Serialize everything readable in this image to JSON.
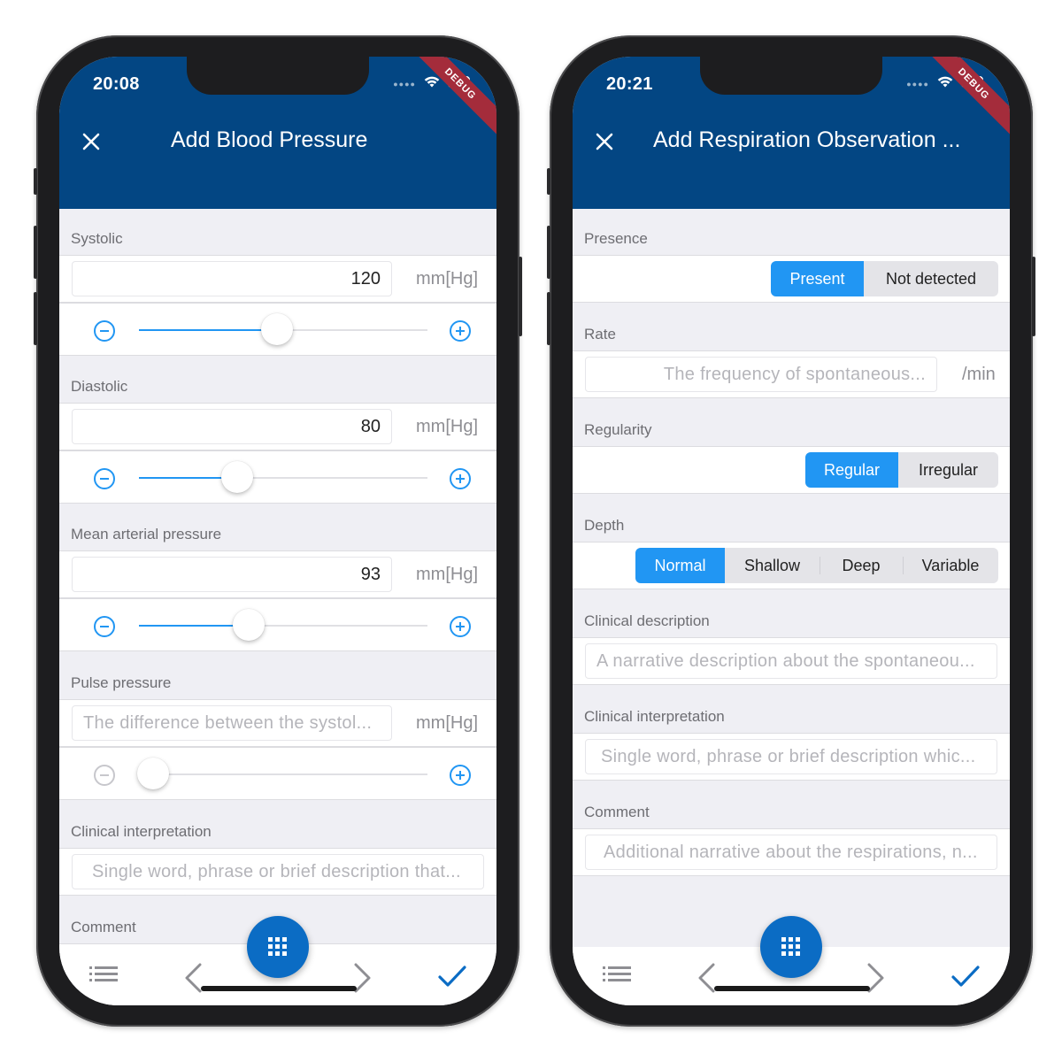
{
  "left_screen": {
    "status_time": "20:08",
    "debug_label": "DEBUG",
    "title": "Add Blood Pressure",
    "systolic": {
      "label": "Systolic",
      "value": "120",
      "unit": "mm[Hg]",
      "slider_level": 0.48
    },
    "diastolic": {
      "label": "Diastolic",
      "value": "80",
      "unit": "mm[Hg]",
      "slider_level": 0.34
    },
    "mean_arterial": {
      "label": "Mean arterial pressure",
      "value": "93",
      "unit": "mm[Hg]",
      "slider_level": 0.38
    },
    "pulse_pressure": {
      "label": "Pulse pressure",
      "placeholder": "The difference between the systol...",
      "unit": "mm[Hg]",
      "slider_level": 0.05
    },
    "clinical_interpretation": {
      "label": "Clinical interpretation",
      "placeholder": "Single word, phrase or brief description that..."
    },
    "comment": {
      "label": "Comment"
    }
  },
  "right_screen": {
    "status_time": "20:21",
    "debug_label": "DEBUG",
    "title": "Add Respiration Observation ...",
    "presence": {
      "label": "Presence",
      "options": [
        "Present",
        "Not detected"
      ],
      "selected": "Present"
    },
    "rate": {
      "label": "Rate",
      "placeholder": "The frequency of spontaneous...",
      "unit": "/min"
    },
    "regularity": {
      "label": "Regularity",
      "options": [
        "Regular",
        "Irregular"
      ],
      "selected": "Regular"
    },
    "depth": {
      "label": "Depth",
      "options": [
        "Normal",
        "Shallow",
        "Deep",
        "Variable"
      ],
      "selected": "Normal"
    },
    "clinical_description": {
      "label": "Clinical description",
      "placeholder": "A narrative description about the spontaneou..."
    },
    "clinical_interpretation": {
      "label": "Clinical interpretation",
      "placeholder": "Single word, phrase or brief description whic..."
    },
    "comment": {
      "label": "Comment",
      "placeholder": "Additional narrative about the respirations, n..."
    }
  },
  "icons": {
    "close": "close-icon",
    "minus": "minus-circle-icon",
    "plus": "plus-circle-icon",
    "list": "list-icon",
    "back": "chevron-left-icon",
    "forward": "chevron-right-icon",
    "grid": "grid-icon",
    "confirm": "check-icon"
  },
  "colors": {
    "app_bar": "#034683",
    "accent": "#2196f3",
    "fab": "#0b6cc4",
    "debug_banner": "#a42c3b"
  }
}
